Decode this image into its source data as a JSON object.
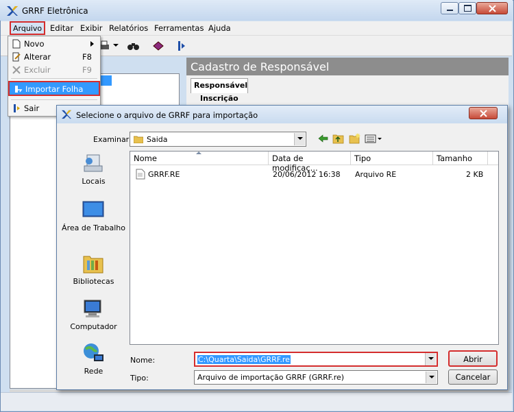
{
  "app": {
    "title": "GRRF Eletrônica"
  },
  "menubar": [
    "Arquivo",
    "Editar",
    "Exibir",
    "Relatórios",
    "Ferramentas",
    "Ajuda"
  ],
  "file_menu": {
    "items": [
      {
        "label": "Novo",
        "shortcut": ""
      },
      {
        "label": "Alterar",
        "shortcut": "F8"
      },
      {
        "label": "Excluir",
        "shortcut": "F9"
      },
      {
        "label": "Importar Folha",
        "shortcut": ""
      },
      {
        "label": "Sair",
        "shortcut": ""
      }
    ]
  },
  "tree": {
    "selected_fragment": "SA"
  },
  "panel": {
    "header": "Cadastro de Responsável",
    "tab": "Responsável",
    "group": "Inscrição"
  },
  "dialog": {
    "title": "Selecione o arquivo de GRRF para importação",
    "lookin_label": "Examinar:",
    "lookin_value": "Saida",
    "places": [
      "Locais",
      "Área de Trabalho",
      "Bibliotecas",
      "Computador",
      "Rede"
    ],
    "columns": [
      "Nome",
      "Data de modificaç...",
      "Tipo",
      "Tamanho"
    ],
    "rows": [
      {
        "name": "GRRF.RE",
        "date": "20/06/2012 16:38",
        "type": "Arquivo RE",
        "size": "2 KB"
      }
    ],
    "name_label": "Nome:",
    "name_value": "C:\\Quarta\\Saida\\GRRF.re",
    "type_label": "Tipo:",
    "type_value": "Arquivo de importação GRRF (GRRF.re)",
    "open_button": "Abrir",
    "cancel_button": "Cancelar"
  },
  "colors": {
    "highlight": "#3399ff",
    "annotation_border": "#d42c2c",
    "panel_header": "#8d8d8d"
  }
}
